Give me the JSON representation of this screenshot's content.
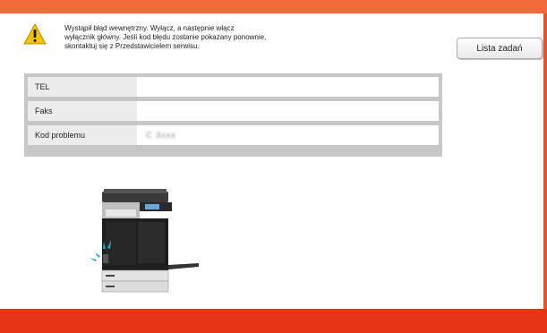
{
  "message": {
    "lines": [
      "Wystąpił błąd wewnętrzny. Wyłącz, a następnie włącz",
      "wyłącznik główny. Jeśli kod błędu zostanie pokazany ponownie,",
      "skontaktuj się z Przedstawicielem serwisu."
    ]
  },
  "buttons": {
    "job_list": "Lista zadań"
  },
  "info": {
    "rows": [
      {
        "label": "TEL",
        "value": ""
      },
      {
        "label": "Faks",
        "value": ""
      },
      {
        "label": "Kod problemu",
        "value": "C 3xxx"
      }
    ]
  },
  "icons": {
    "warning": "warning-icon",
    "device": "printer-illustration"
  },
  "colors": {
    "top_bar": "#f06a3a",
    "bottom_bar": "#e53512",
    "warning_yellow": "#f5c400",
    "panel_gray": "#c7c7c7"
  }
}
